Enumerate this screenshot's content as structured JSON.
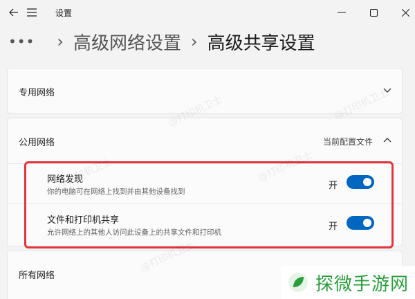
{
  "window": {
    "title": "设置"
  },
  "breadcrumb": {
    "more": "•••",
    "parent": "高级网络设置",
    "separator": "›",
    "current": "高级共享设置"
  },
  "private_network": {
    "title": "专用网络"
  },
  "public_network": {
    "title": "公用网络",
    "profile_label": "当前配置文件",
    "settings": [
      {
        "title": "网络发现",
        "description": "你的电脑可在网络上找到并由其他设备找到",
        "state_label": "开",
        "enabled": true
      },
      {
        "title": "文件和打印机共享",
        "description": "允许网络上的其他人访问此设备上的共享文件和打印机",
        "state_label": "开",
        "enabled": true
      }
    ]
  },
  "all_networks": {
    "title": "所有网络"
  },
  "watermark": {
    "text": "@打印机卫士",
    "brand": "探微手游网"
  },
  "colors": {
    "accent": "#0067c0",
    "highlight": "#e3343b",
    "brand": "#2a9d3c"
  }
}
